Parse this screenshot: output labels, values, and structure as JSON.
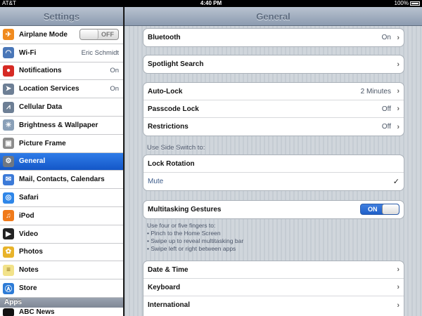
{
  "status_bar": {
    "carrier": "AT&T",
    "time": "4:40 PM",
    "battery": "100%"
  },
  "sidebar": {
    "title": "Settings",
    "items": [
      {
        "label": "Airplane Mode",
        "icon": "airplane-icon",
        "color": "#f08a1e",
        "toggle": "OFF"
      },
      {
        "label": "Wi-Fi",
        "icon": "wifi-icon",
        "color": "#4a77b8",
        "value": "Eric Schmidt"
      },
      {
        "label": "Notifications",
        "icon": "notifications-icon",
        "color": "#d62a24",
        "value": "On"
      },
      {
        "label": "Location Services",
        "icon": "location-icon",
        "color": "#6d7f95",
        "value": "On"
      },
      {
        "label": "Cellular Data",
        "icon": "cellular-icon",
        "color": "#6d7f95"
      },
      {
        "label": "Brightness & Wallpaper",
        "icon": "brightness-icon",
        "color": "#8aa0b8"
      },
      {
        "label": "Picture Frame",
        "icon": "picture-frame-icon",
        "color": "#8c8c8c"
      },
      {
        "label": "General",
        "icon": "gear-icon",
        "color": "#6e7783"
      },
      {
        "label": "Mail, Contacts, Calendars",
        "icon": "mail-icon",
        "color": "#3b7ad8"
      },
      {
        "label": "Safari",
        "icon": "safari-icon",
        "color": "#2f86e8"
      },
      {
        "label": "iPod",
        "icon": "ipod-icon",
        "color": "#f07a1a"
      },
      {
        "label": "Video",
        "icon": "video-icon",
        "color": "#222222"
      },
      {
        "label": "Photos",
        "icon": "photos-icon",
        "color": "#e8b32a"
      },
      {
        "label": "Notes",
        "icon": "notes-icon",
        "color": "#f2e28a"
      },
      {
        "label": "Store",
        "icon": "store-icon",
        "color": "#2d7bd6"
      }
    ],
    "apps_header": "Apps",
    "apps_items": [
      {
        "label": "ABC News",
        "icon": "abc-news-icon",
        "color": "#111111"
      }
    ]
  },
  "detail": {
    "title": "General",
    "bluetooth": {
      "label": "Bluetooth",
      "value": "On"
    },
    "spotlight": {
      "label": "Spotlight Search"
    },
    "autolock": {
      "label": "Auto-Lock",
      "value": "2 Minutes"
    },
    "passcode": {
      "label": "Passcode Lock",
      "value": "Off"
    },
    "restrictions": {
      "label": "Restrictions",
      "value": "Off"
    },
    "side_switch_label": "Use Side Switch to:",
    "lock_rotation": {
      "label": "Lock Rotation"
    },
    "mute": {
      "label": "Mute"
    },
    "multitasking": {
      "label": "Multitasking Gestures",
      "toggle": "ON"
    },
    "gesture_notes": [
      "Use four or five fingers to:",
      "• Pinch to the Home Screen",
      "• Swipe up to reveal multitasking bar",
      "• Swipe left or right between apps"
    ],
    "date_time": {
      "label": "Date & Time"
    },
    "keyboard": {
      "label": "Keyboard"
    },
    "international": {
      "label": "International"
    }
  }
}
